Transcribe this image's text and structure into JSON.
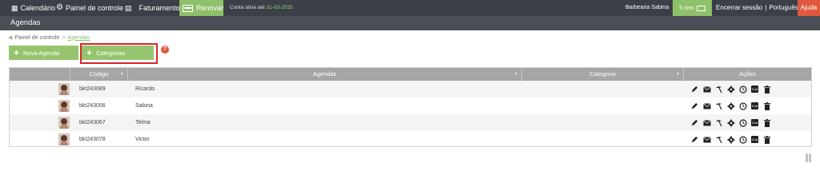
{
  "topbar": {
    "calendar_label": "Calendário",
    "dashboard_label": "Painel de controle",
    "billing_label": "Faturamento",
    "renew_label": "Renovar",
    "account_prefix": "Conta ativa até",
    "account_date": "31-03-2025",
    "business_name": "Barbearia Sabina",
    "sms_label": "5 sms",
    "logout_label": "Encerrar sessão",
    "separator": "|",
    "language_label": "Português",
    "help_label": "Ajuda"
  },
  "page_title": "Agendas",
  "breadcrumb": {
    "root": "Painel de controle",
    "separator": ">",
    "current": "Agendas"
  },
  "buttons": {
    "new_agenda": "Nova Agenda",
    "categories": "Categorias",
    "help_q": "?"
  },
  "table": {
    "columns": {
      "code": "Código",
      "agendas": "Agendas",
      "category": "Categoria",
      "actions": "Ações"
    },
    "rows": [
      {
        "code": "bkt243089",
        "name": "Ricardo",
        "category": ""
      },
      {
        "code": "bkt243056",
        "name": "Sabina",
        "category": ""
      },
      {
        "code": "bkt243067",
        "name": "Telma",
        "category": ""
      },
      {
        "code": "bkt243078",
        "name": "Victor",
        "category": ""
      }
    ],
    "action_icons": [
      "edit-icon",
      "envelope-icon",
      "beach-icon",
      "gear-icon",
      "clock-icon",
      "ical-icon",
      "trash-icon"
    ],
    "ical_label": "iCal"
  },
  "colors": {
    "topbar": "#3b3f47",
    "subbar": "#4a4e56",
    "accent_green": "#96c46e",
    "help_red": "#e0593e",
    "highlight_red": "#d9252a",
    "table_header": "#a6a6a6"
  }
}
